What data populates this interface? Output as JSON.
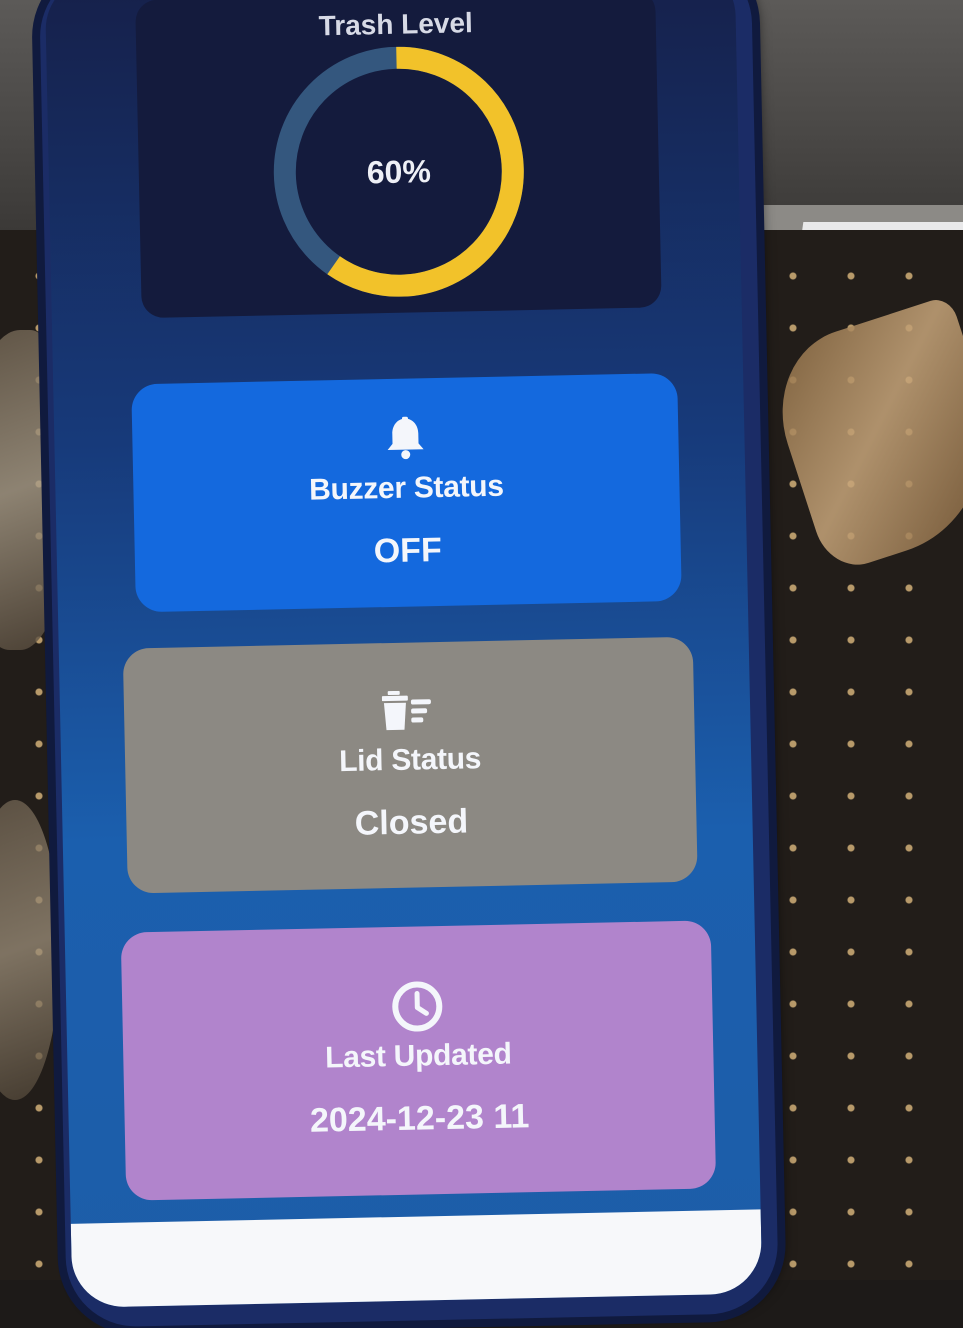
{
  "trash_level": {
    "title": "Trash Level",
    "percent_label": "60%",
    "percent_value": 60,
    "fill_color": "#f2c22a",
    "track_color": "#34577e"
  },
  "buzzer": {
    "icon": "bell-icon",
    "label": "Buzzer Status",
    "value": "OFF",
    "color": "#1469de"
  },
  "lid": {
    "icon": "trash-bin-icon",
    "label": "Lid Status",
    "value": "Closed",
    "color": "#8c8983"
  },
  "last_updated": {
    "icon": "clock-icon",
    "label": "Last Updated",
    "value": "2024-12-23 11",
    "color": "#b184cc"
  }
}
